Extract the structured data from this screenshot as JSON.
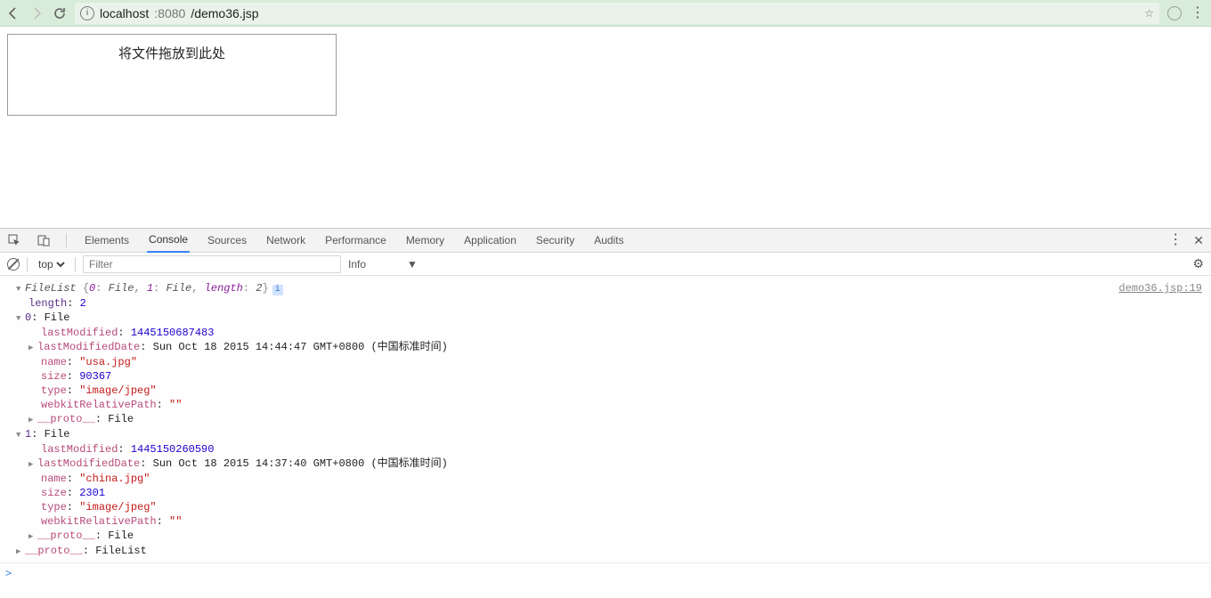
{
  "toolbar": {
    "url_host": "localhost",
    "url_port": ":8080",
    "url_path": "/demo36.jsp"
  },
  "page": {
    "dropzone_text": "将文件拖放到此处"
  },
  "devtools": {
    "tabs": [
      "Elements",
      "Console",
      "Sources",
      "Network",
      "Performance",
      "Memory",
      "Application",
      "Security",
      "Audits"
    ],
    "active_tab": "Console",
    "context": "top",
    "filter_placeholder": "Filter",
    "level_label": "Info",
    "source_ref": "demo36.jsp:19"
  },
  "console": {
    "header_type": "FileList",
    "header_summary_open": "{",
    "header_summary_close": "}",
    "header_k0": "0",
    "header_v0": "File",
    "header_k1": "1",
    "header_v1": "File",
    "header_klen": "length",
    "header_vlen": "2",
    "length_key": "length",
    "length_val": "2",
    "item0": {
      "idx": "0",
      "type": "File",
      "lastModified_k": "lastModified",
      "lastModified_v": "1445150687483",
      "lastModifiedDate_k": "lastModifiedDate",
      "lastModifiedDate_v": "Sun Oct 18 2015 14:44:47 GMT+0800 (中国标准时间)",
      "name_k": "name",
      "name_v": "\"usa.jpg\"",
      "size_k": "size",
      "size_v": "90367",
      "type_k": "type",
      "type_v": "\"image/jpeg\"",
      "wrp_k": "webkitRelativePath",
      "wrp_v": "\"\"",
      "proto_k": "__proto__",
      "proto_v": "File"
    },
    "item1": {
      "idx": "1",
      "type": "File",
      "lastModified_k": "lastModified",
      "lastModified_v": "1445150260590",
      "lastModifiedDate_k": "lastModifiedDate",
      "lastModifiedDate_v": "Sun Oct 18 2015 14:37:40 GMT+0800 (中国标准时间)",
      "name_k": "name",
      "name_v": "\"china.jpg\"",
      "size_k": "size",
      "size_v": "2301",
      "type_k": "type",
      "type_v": "\"image/jpeg\"",
      "wrp_k": "webkitRelativePath",
      "wrp_v": "\"\"",
      "proto_k": "__proto__",
      "proto_v": "File"
    },
    "list_proto_k": "__proto__",
    "list_proto_v": "FileList",
    "prompt": ">"
  }
}
